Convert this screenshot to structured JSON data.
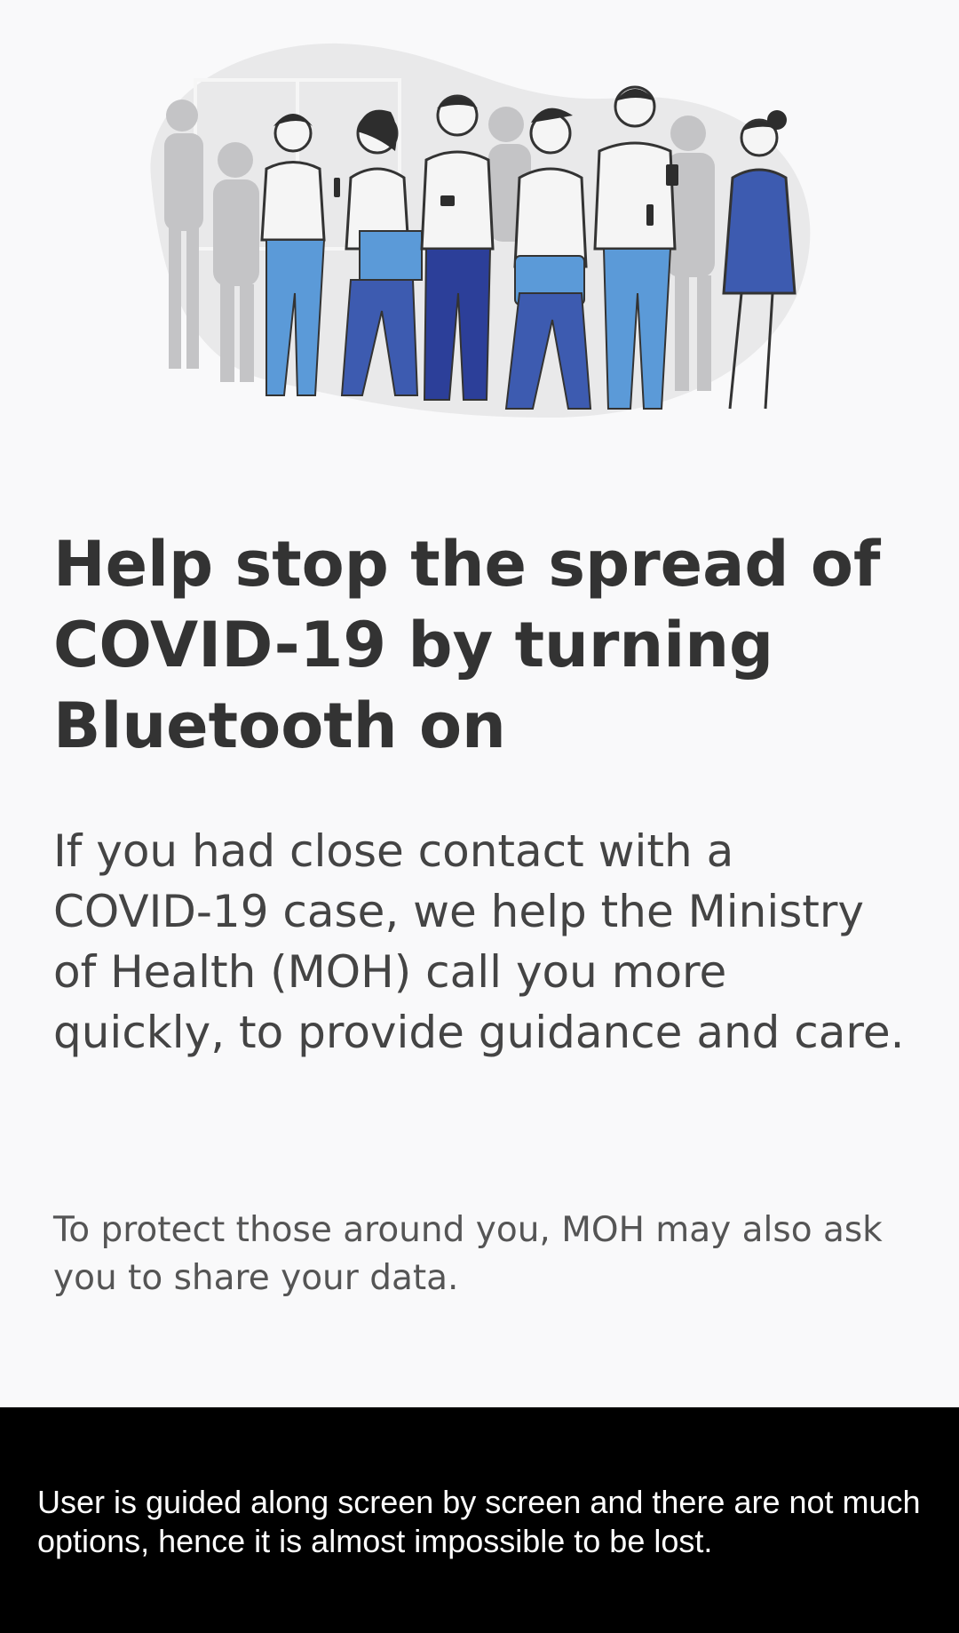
{
  "onboarding": {
    "headline": "Help stop the spread of COVID-19 by turning Bluetooth on",
    "body": "If you had close contact with a COVID-19 case, we help the Ministry of Health (MOH) call you more quickly, to provide guidance and care.",
    "note": "To protect those around you, MOH may also ask you to share your data.",
    "illustration_icon": "people-crowd-illustration"
  },
  "caption": {
    "text": "User is guided along screen by screen and there are not much options, hence it is almost impossible to be lost."
  },
  "colors": {
    "background": "#f9f9fa",
    "headline": "#333333",
    "body": "#444444",
    "accent_blue": "#3d5bb0",
    "light_blue": "#5b9ad8",
    "caption_background": "#000000",
    "caption_text": "#ffffff"
  }
}
